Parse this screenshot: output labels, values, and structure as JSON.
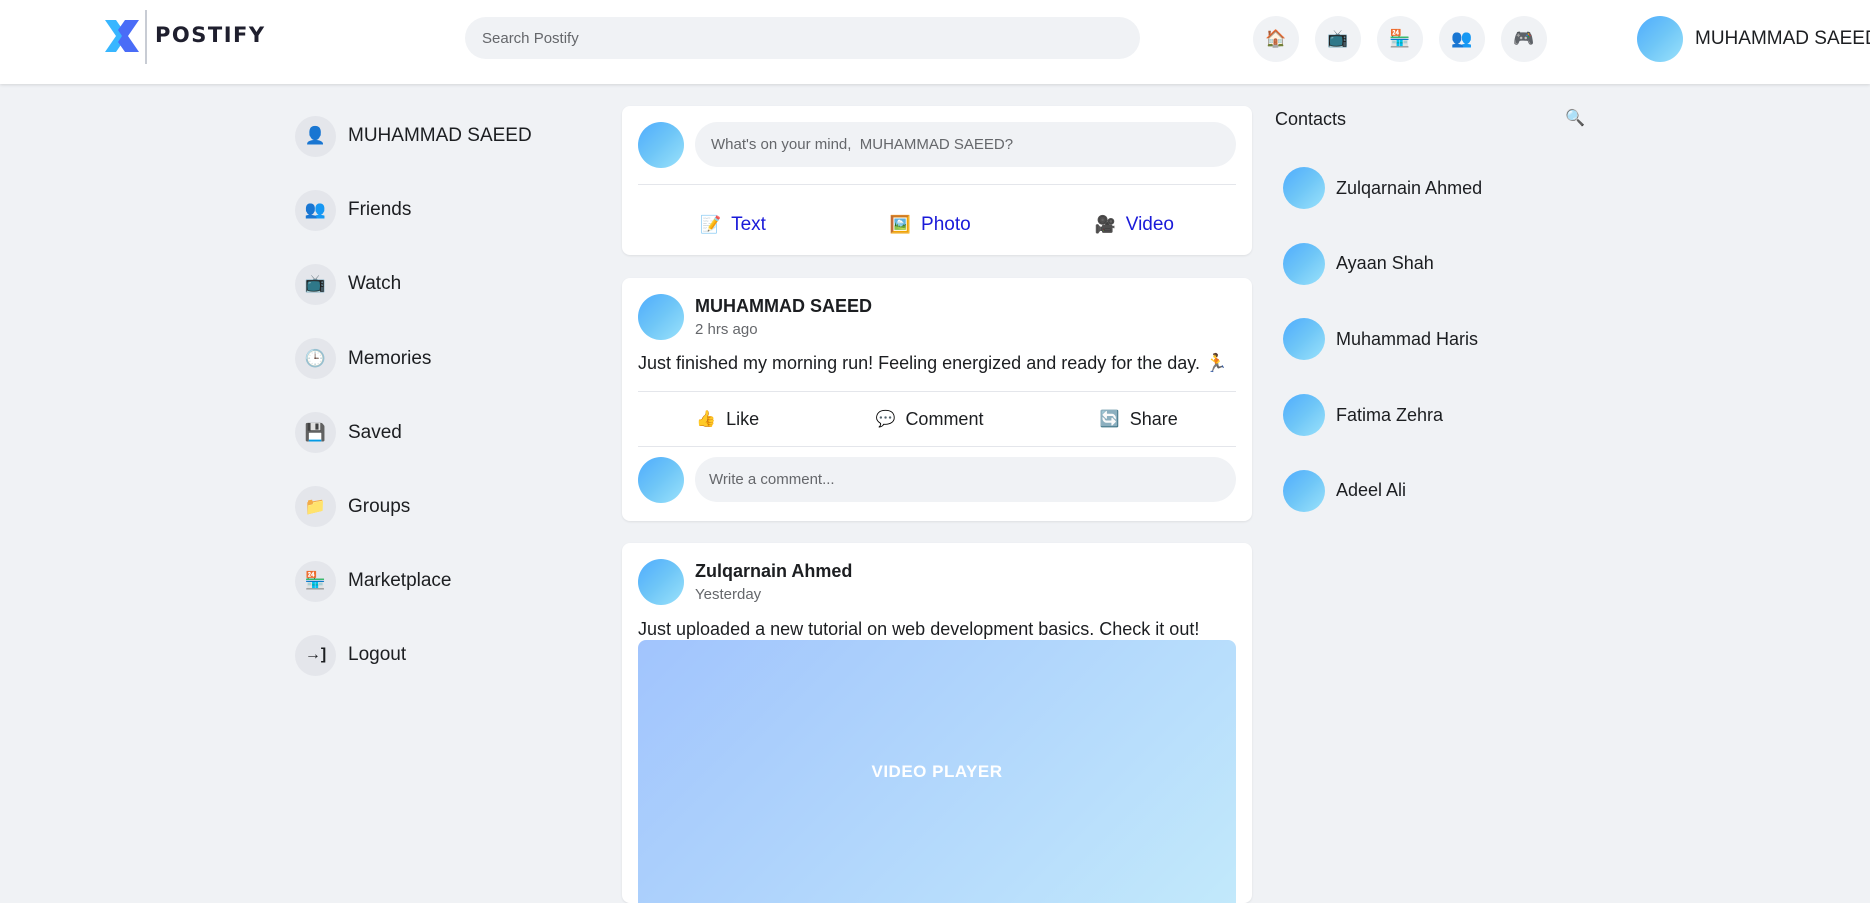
{
  "brand": {
    "name": "POSTIFY",
    "accent": "#4a6cf7",
    "accent2": "#38b6ff"
  },
  "search": {
    "placeholder": "Search Postify"
  },
  "header_nav": [
    {
      "name": "home-icon",
      "glyph": "🏠"
    },
    {
      "name": "watch-icon",
      "glyph": "📺"
    },
    {
      "name": "marketplace-icon",
      "glyph": "🏪"
    },
    {
      "name": "friends-icon",
      "glyph": "👥"
    },
    {
      "name": "gaming-icon",
      "glyph": "🎮"
    }
  ],
  "user": {
    "name": "MUHAMMAD SAEED"
  },
  "sidebar": {
    "items": [
      {
        "label": "MUHAMMAD SAEED",
        "icon": "profile-icon",
        "glyph": "👤"
      },
      {
        "label": "Friends",
        "icon": "friends-icon",
        "glyph": "👥"
      },
      {
        "label": "Watch",
        "icon": "watch-icon",
        "glyph": "📺"
      },
      {
        "label": "Memories",
        "icon": "clock-icon",
        "glyph": "🕒"
      },
      {
        "label": "Saved",
        "icon": "save-icon",
        "glyph": "💾"
      },
      {
        "label": "Groups",
        "icon": "folder-icon",
        "glyph": "📁"
      },
      {
        "label": "Marketplace",
        "icon": "marketplace-icon",
        "glyph": "🏪"
      },
      {
        "label": "Logout",
        "icon": "logout-icon",
        "glyph": "→]"
      }
    ]
  },
  "composer": {
    "placeholder": "What's on your mind,  MUHAMMAD SAEED?",
    "actions": [
      {
        "label": "Text",
        "icon": "text-icon",
        "glyph": "📝"
      },
      {
        "label": "Photo",
        "icon": "photo-icon",
        "glyph": "🖼️"
      },
      {
        "label": "Video",
        "icon": "video-camera-icon",
        "glyph": "🎥"
      }
    ],
    "action_color": "#1a1ad9"
  },
  "posts": [
    {
      "author": "MUHAMMAD SAEED",
      "time": "2 hrs ago",
      "text": "Just finished my morning run! Feeling energized and ready for the day. 🏃",
      "actions": [
        {
          "label": "Like",
          "icon": "like-icon",
          "glyph": "👍"
        },
        {
          "label": "Comment",
          "icon": "comment-icon",
          "glyph": "💬"
        },
        {
          "label": "Share",
          "icon": "share-icon",
          "glyph": "🔄"
        }
      ],
      "comment_placeholder": "Write a comment..."
    },
    {
      "author": "Zulqarnain Ahmed",
      "time": "Yesterday",
      "text": "Just uploaded a new tutorial on web development basics. Check it out!",
      "video_label": "VIDEO PLAYER"
    }
  ],
  "contacts": {
    "title": "Contacts",
    "search_icon": "🔍",
    "items": [
      {
        "name": "Zulqarnain Ahmed"
      },
      {
        "name": "Ayaan Shah"
      },
      {
        "name": "Muhammad Haris"
      },
      {
        "name": "Fatima Zehra"
      },
      {
        "name": "Adeel Ali"
      }
    ]
  }
}
